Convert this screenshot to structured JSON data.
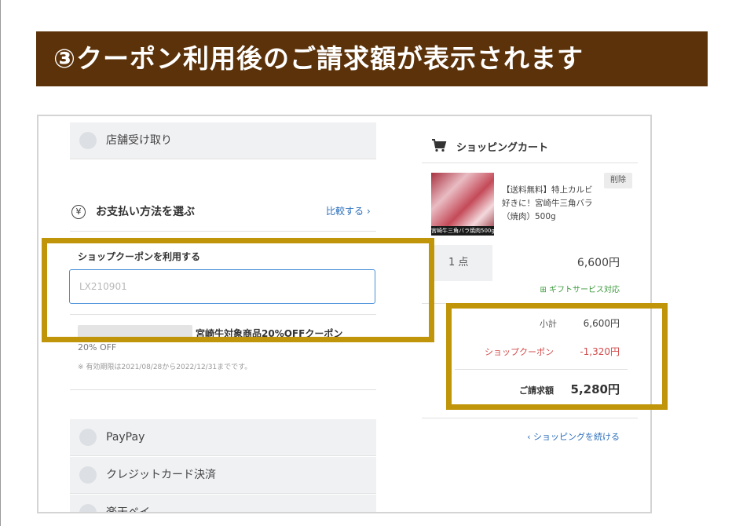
{
  "title": "③クーポン利用後のご請求額が表示されます",
  "colors": {
    "banner": "#5b3209",
    "highlight": "#c0950a",
    "link": "#2a6ebb",
    "discount": "#d34a4a",
    "gift": "#3a9a3a"
  },
  "left": {
    "store_pickup": {
      "label": "店舗受け取り",
      "icon": "radio-icon"
    },
    "payment": {
      "icon": "yen-icon",
      "title": "お支払い方法を選ぶ",
      "compare": "比較する ›"
    },
    "coupon": {
      "section_title": "ショップクーポンを利用する",
      "input_value": "LX210901",
      "name": "宮崎牛対象商品20%OFFクーポン",
      "discount": "20% OFF",
      "expiry": "※ 有効期限は2021/08/28から2022/12/31までです。"
    },
    "payment_methods": [
      {
        "label": "PayPay"
      },
      {
        "label": "クレジットカード決済"
      },
      {
        "label": "楽天ペイ"
      }
    ]
  },
  "cart": {
    "icon": "cart-icon",
    "title": "ショッピングカート",
    "product": {
      "name": "【送料無料】特上カルビ好きに！宮崎牛三角バラ（焼肉）500g",
      "image_caption": "宮崎牛三角バラ焼肉500g",
      "delete_label": "削除"
    },
    "quantity": "1 点",
    "line_price": "6,600円",
    "gift_service": "⊞ ギフトサービス対応",
    "summary": {
      "subtotal_label": "小計",
      "subtotal_value": "6,600円",
      "coupon_label": "ショップクーポン",
      "coupon_value": "-1,320円",
      "total_label": "ご請求額",
      "total_value": "5,280円"
    },
    "continue_label": "‹ ショッピングを続ける"
  }
}
